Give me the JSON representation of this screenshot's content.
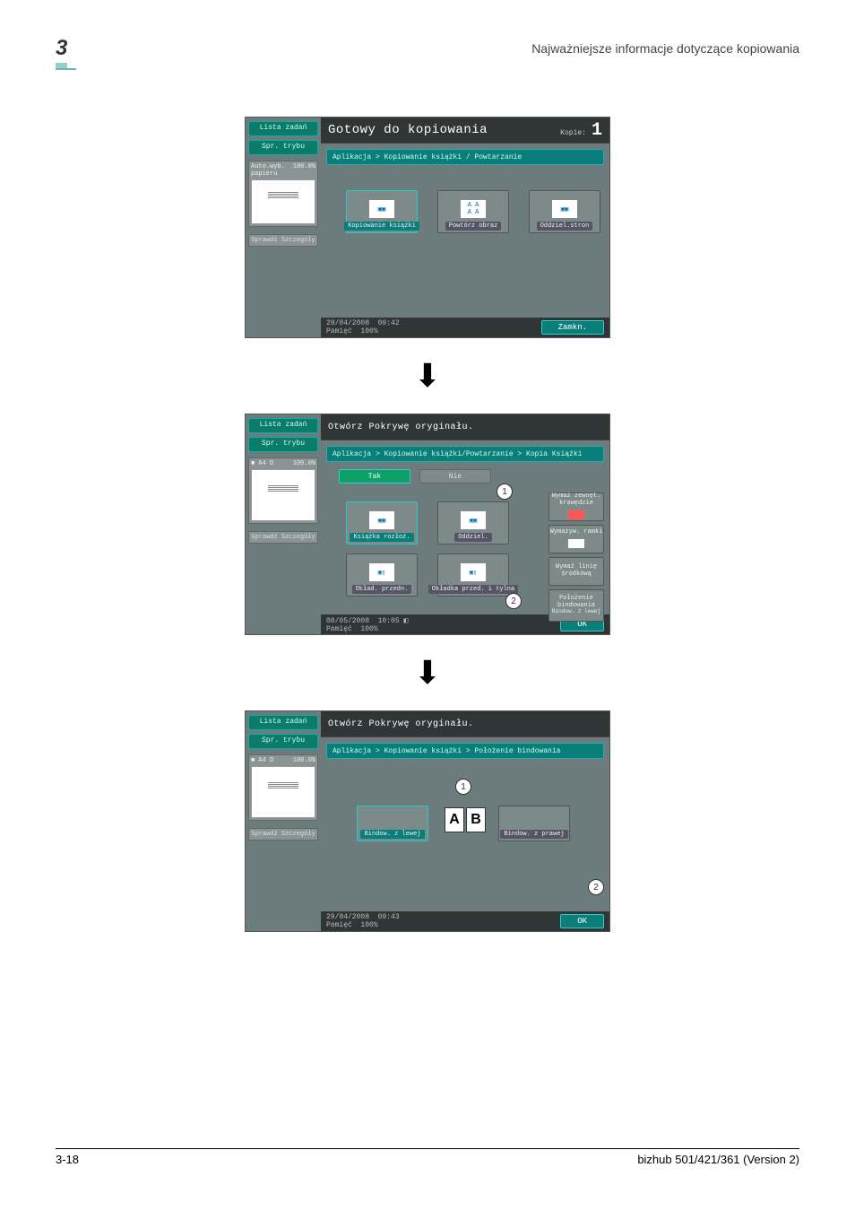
{
  "header": {
    "chapter": "3",
    "title": "Najważniejsze informacje dotyczące kopiowania"
  },
  "footer": {
    "page": "3-18",
    "model": "bizhub 501/421/361 (Version 2)"
  },
  "sidebar": {
    "jobs": "Lista zadań",
    "mode": "Spr. trybu",
    "auto": "Auto.wyb. papieru",
    "p100": "100.0%",
    "a4": "A4 D",
    "details": "Sprawdź Szczegóły"
  },
  "s1": {
    "title": "Gotowy do kopiowania",
    "copies_lbl": "Kopie:",
    "copies": "1",
    "crumb": "Aplikacja > Kopiowanie książki / Powtarzanie",
    "t1": "Kopiowanie książki",
    "t2": "Powtórz obraz",
    "t3": "Oddziel.stron",
    "date": "29/04/2008",
    "time": "09:42",
    "mem_lbl": "Pamięć",
    "mem": "100%",
    "close": "Zamkn."
  },
  "s2": {
    "title": "Otwórz Pokrywę oryginału.",
    "crumb": "Aplikacja > Kopiowanie książki/Powtarzanie > Kopia Książki",
    "yes": "Tak",
    "no": "Nie",
    "t1": "Książka rozłoż.",
    "t2": "Oddziel.",
    "t3": "Okład. przedn.",
    "t4": "Okładka przed. i tylna",
    "r1": "Wymaż zewnęt. krawędzie",
    "r2": "Wymazyw. ramki",
    "r3": "Wymaż linię środkową",
    "r4": "Położenie bindowania",
    "r5": "Bindow. z lewej",
    "date": "08/05/2008",
    "time": "10:05",
    "mem_lbl": "Pamięć",
    "mem": "100%",
    "ok": "OK"
  },
  "s3": {
    "title": "Otwórz Pokrywę oryginału.",
    "crumb": "Aplikacja > Kopiowanie książki > Położenie bindowania",
    "t1": "Bindow. z lewej",
    "t2": "Bindow. z prawej",
    "date": "29/04/2008",
    "time": "09:43",
    "mem_lbl": "Pamięć",
    "mem": "100%",
    "ok": "OK"
  }
}
